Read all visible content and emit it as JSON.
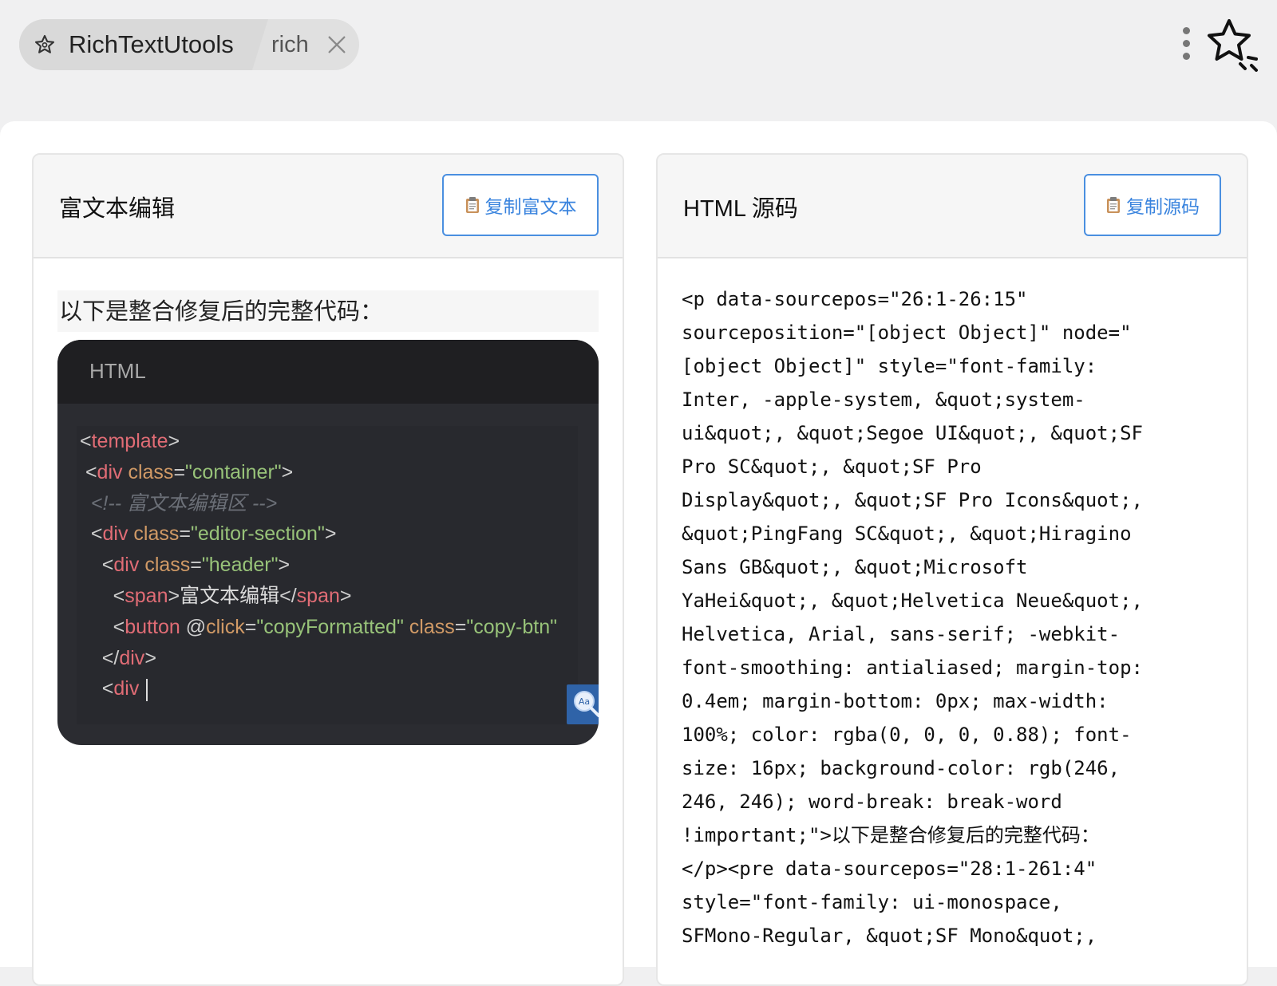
{
  "window": {
    "app_title": "RichTextUtools",
    "query": "rich",
    "icons": {
      "app": "star-outline-icon",
      "close": "close-icon",
      "more": "more-vertical-icon",
      "favorite": "star-sparkle-icon"
    }
  },
  "left_panel": {
    "title": "富文本编辑",
    "copy_button": "复制富文本",
    "intro": "以下是整合修复后的完整代码：",
    "code_lang": "HTML",
    "code_lines": [
      [
        [
          "p",
          "<"
        ],
        [
          "t",
          "template"
        ],
        [
          "p",
          ">"
        ]
      ],
      [
        [
          "p",
          " <"
        ],
        [
          "t",
          "div"
        ],
        [
          "p",
          " "
        ],
        [
          "a",
          "class"
        ],
        [
          "p",
          "="
        ],
        [
          "s",
          "\"container\""
        ],
        [
          "p",
          ">"
        ]
      ],
      [
        [
          "c",
          "  <!-- 富文本编辑区 -->"
        ]
      ],
      [
        [
          "p",
          "  <"
        ],
        [
          "t",
          "div"
        ],
        [
          "p",
          " "
        ],
        [
          "a",
          "class"
        ],
        [
          "p",
          "="
        ],
        [
          "s",
          "\"editor-section\""
        ],
        [
          "p",
          ">"
        ]
      ],
      [
        [
          "p",
          "    <"
        ],
        [
          "t",
          "div"
        ],
        [
          "p",
          " "
        ],
        [
          "a",
          "class"
        ],
        [
          "p",
          "="
        ],
        [
          "s",
          "\"header\""
        ],
        [
          "p",
          ">"
        ]
      ],
      [
        [
          "p",
          "      <"
        ],
        [
          "t",
          "span"
        ],
        [
          "p",
          ">"
        ],
        [
          "n",
          "富文本编辑"
        ],
        [
          "p",
          "</"
        ],
        [
          "t",
          "span"
        ],
        [
          "p",
          ">"
        ]
      ],
      [
        [
          "p",
          "      <"
        ],
        [
          "t",
          "button"
        ],
        [
          "p",
          " @"
        ],
        [
          "a",
          "click"
        ],
        [
          "p",
          "="
        ],
        [
          "s",
          "\"copyFormatted\""
        ],
        [
          "p",
          " "
        ],
        [
          "a",
          "class"
        ],
        [
          "p",
          "="
        ],
        [
          "s",
          "\"copy-btn\""
        ]
      ],
      [
        [
          "p",
          "    </"
        ],
        [
          "t",
          "div"
        ],
        [
          "p",
          ">"
        ]
      ],
      [
        [
          "p",
          "    <"
        ],
        [
          "t",
          "div"
        ],
        [
          "p",
          " "
        ]
      ]
    ]
  },
  "right_panel": {
    "title": "HTML 源码",
    "copy_button": "复制源码",
    "source_lines": [
      "<p data-sourcepos=\"26:1-26:15\"",
      "sourceposition=\"[object Object]\" node=\"",
      "[object Object]\" style=\"font-family:",
      "Inter, -apple-system, &quot;system-",
      "ui&quot;, &quot;Segoe UI&quot;, &quot;SF",
      "Pro SC&quot;, &quot;SF Pro",
      "Display&quot;, &quot;SF Pro Icons&quot;,",
      "&quot;PingFang SC&quot;, &quot;Hiragino",
      "Sans GB&quot;, &quot;Microsoft",
      "YaHei&quot;, &quot;Helvetica Neue&quot;,",
      "Helvetica, Arial, sans-serif; -webkit-",
      "font-smoothing: antialiased; margin-top:",
      "0.4em; margin-bottom: 0px; max-width:",
      "100%; color: rgba(0, 0, 0, 0.88); font-",
      "size: 16px; background-color: rgb(246,",
      "246, 246); word-break: break-word",
      "!important;\">以下是整合修复后的完整代码：",
      "</p><pre data-sourcepos=\"28:1-261:4\"",
      "style=\"font-family: ui-monospace,",
      "SFMono-Regular, &quot;SF Mono&quot;,"
    ]
  },
  "colors": {
    "accent": "#3a84de",
    "code_bg": "#2b2c31",
    "tag": "#e06c75",
    "attr": "#d19a66",
    "string": "#98c379",
    "comment": "#6b6f77"
  }
}
